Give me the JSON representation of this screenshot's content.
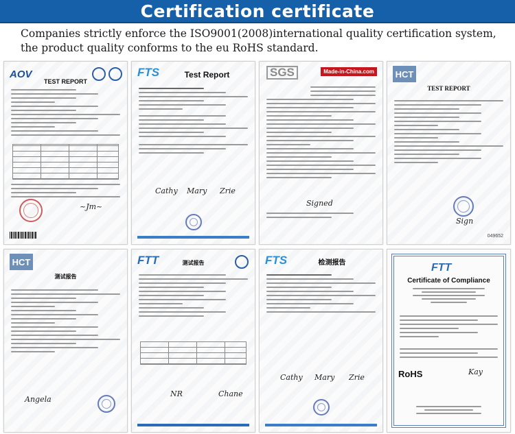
{
  "banner": {
    "title": "Certification certificate"
  },
  "intro": {
    "line1": "Companies strictly enforce the ISO9001(2008)international quality certification system,",
    "line2": "the product quality conforms to the eu RoHS standard."
  },
  "documents": [
    {
      "id": "aov-test-report",
      "logo": "AOV",
      "title": "TEST REPORT"
    },
    {
      "id": "fts-test-report",
      "logo": "FTS",
      "title": "Test Report"
    },
    {
      "id": "sgs-report",
      "logo": "SGS",
      "badge": "Made-in-China.com"
    },
    {
      "id": "hct-test-report",
      "logo": "HCT",
      "title": "TEST REPORT",
      "number": "049652"
    },
    {
      "id": "hct-cn-report",
      "logo": "HCT",
      "title": "测试报告"
    },
    {
      "id": "ftt-cn-report",
      "logo": "FTT",
      "title": "测试报告"
    },
    {
      "id": "fts-cn-report",
      "logo": "FTS",
      "title": "检测报告"
    },
    {
      "id": "ftt-compliance",
      "logo": "FTT",
      "title": "Certificate of Compliance",
      "mark": "RoHS"
    }
  ]
}
